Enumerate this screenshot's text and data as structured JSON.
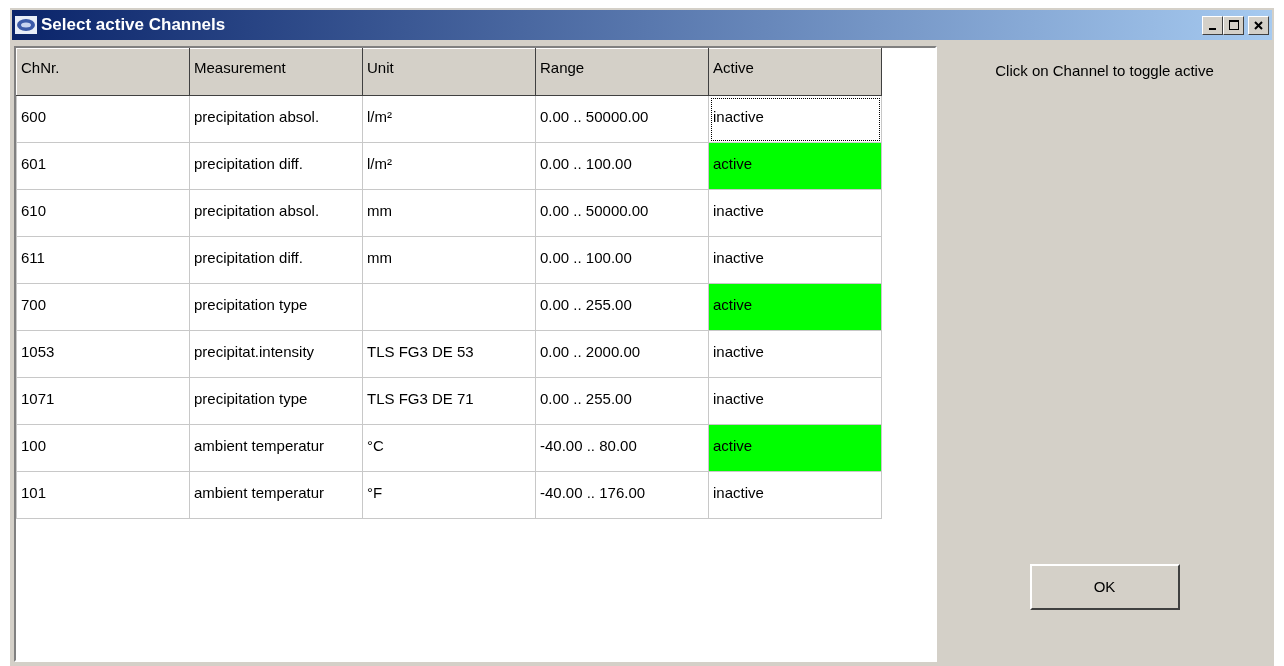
{
  "window": {
    "title": "Select active Channels"
  },
  "table": {
    "columns": [
      "ChNr.",
      "Measurement",
      "Unit",
      "Range",
      "Active"
    ],
    "rows": [
      {
        "cells": [
          "600",
          "precipitation absol.",
          "l/m²",
          "0.00 .. 50000.00",
          "inactive"
        ],
        "active": false,
        "focused": true
      },
      {
        "cells": [
          "601",
          "precipitation diff.",
          "l/m²",
          "0.00 .. 100.00",
          "active"
        ],
        "active": true,
        "focused": false
      },
      {
        "cells": [
          "610",
          "precipitation absol.",
          "mm",
          "0.00 .. 50000.00",
          "inactive"
        ],
        "active": false,
        "focused": false
      },
      {
        "cells": [
          "611",
          "precipitation diff.",
          "mm",
          "0.00 .. 100.00",
          "inactive"
        ],
        "active": false,
        "focused": false
      },
      {
        "cells": [
          "700",
          "precipitation type",
          "",
          "0.00 .. 255.00",
          "active"
        ],
        "active": true,
        "focused": false
      },
      {
        "cells": [
          "1053",
          "precipitat.intensity",
          "TLS FG3 DE 53",
          "0.00 .. 2000.00",
          "inactive"
        ],
        "active": false,
        "focused": false
      },
      {
        "cells": [
          "1071",
          "precipitation type",
          "TLS FG3 DE 71",
          "0.00 .. 255.00",
          "inactive"
        ],
        "active": false,
        "focused": false
      },
      {
        "cells": [
          "100",
          "ambient temperatur",
          "°C",
          "-40.00 .. 80.00",
          "active"
        ],
        "active": true,
        "focused": false
      },
      {
        "cells": [
          "101",
          "ambient temperatur",
          "°F",
          "-40.00 .. 176.00",
          "inactive"
        ],
        "active": false,
        "focused": false
      }
    ]
  },
  "hint": "Click on Channel to toggle active",
  "buttons": [
    "OK"
  ]
}
